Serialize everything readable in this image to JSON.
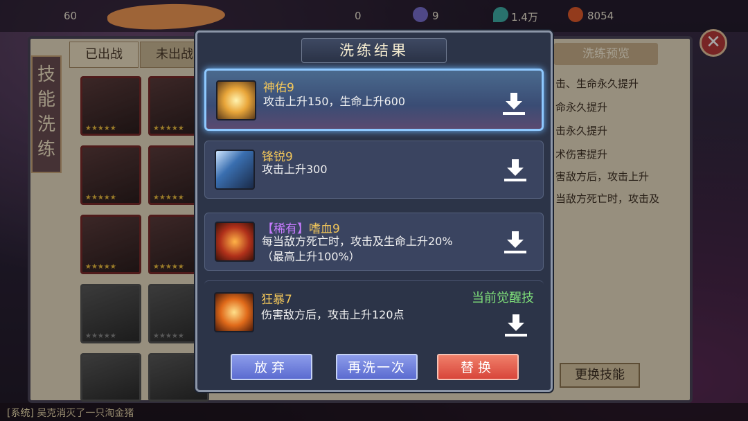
{
  "topbar": {
    "level": "60",
    "gem_count": "9",
    "water_count": "1.4万",
    "coin_count": "8054",
    "zero_count": "0"
  },
  "background": {
    "side_title": "技能洗练",
    "tabs": [
      "已出战",
      "未出战"
    ],
    "preview_title": "洗练预览",
    "preview_lines": [
      "击、生命永久提升",
      "命永久提升",
      "击永久提升",
      "术伤害提升",
      "害敌方后，攻击上升",
      "当敌方死亡时，攻击及"
    ],
    "change_skill_label": "更换技能",
    "chat_prefix": "[系统]",
    "chat_text": "吴克消灭了一只淘金猪"
  },
  "modal": {
    "title": "洗练结果",
    "skills": [
      {
        "name": "神佑9",
        "desc": "攻击上升150，生命上升600",
        "icon": "spiral-light-icon"
      },
      {
        "name": "锋锐9",
        "desc": "攻击上升300",
        "icon": "blade-icon"
      },
      {
        "rare_tag": "【稀有】",
        "name": "嗜血9",
        "desc": "每当敌方死亡时，攻击及生命上升20%",
        "desc2": "（最高上升100%）",
        "icon": "bloodlust-icon"
      },
      {
        "name": "狂暴7",
        "desc": "伤害敌方后，攻击上升120点",
        "awakened": "当前觉醒技",
        "icon": "berserk-icon"
      }
    ],
    "buttons": {
      "abandon": "放弃",
      "reroll": "再洗一次",
      "replace": "替换"
    }
  },
  "colors": {
    "accent_gold": "#f3c75a",
    "rare_purple": "#c77bff",
    "awake_green": "#7fe07a",
    "replace_red": "#d8453a",
    "button_blue": "#5b6bd0"
  }
}
